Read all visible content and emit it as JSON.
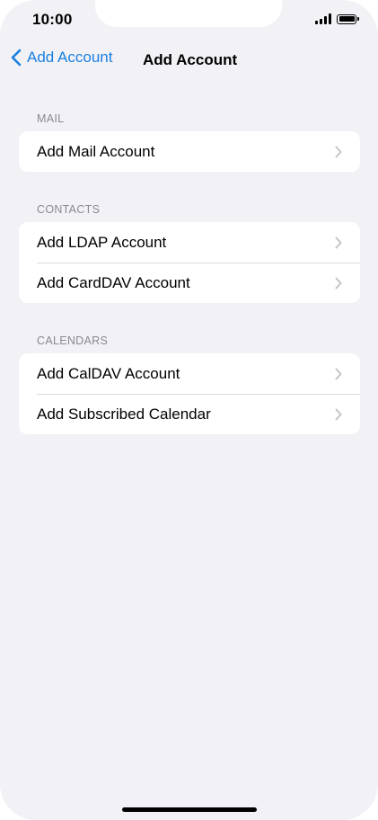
{
  "status_bar": {
    "time": "10:00"
  },
  "nav": {
    "back_label": "Add Account",
    "title": "Add Account"
  },
  "sections": [
    {
      "header": "MAIL",
      "items": [
        {
          "label": "Add Mail Account"
        }
      ]
    },
    {
      "header": "CONTACTS",
      "items": [
        {
          "label": "Add LDAP Account"
        },
        {
          "label": "Add CardDAV Account"
        }
      ]
    },
    {
      "header": "CALENDARS",
      "items": [
        {
          "label": "Add CalDAV Account"
        },
        {
          "label": "Add Subscribed Calendar"
        }
      ]
    }
  ],
  "colors": {
    "accent": "#1a7fde",
    "background": "#f1f1f6",
    "chevron": "#c4c4c7",
    "section_header": "#8a8a8e"
  }
}
